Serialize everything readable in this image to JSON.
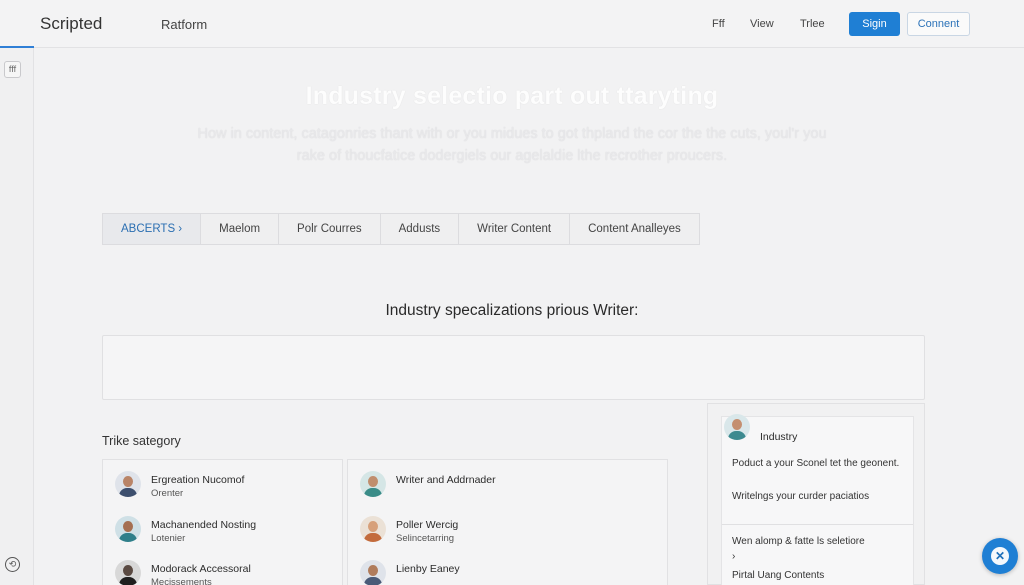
{
  "header": {
    "brand": "Scripted",
    "platform": "Ratform",
    "nav": [
      "Fff",
      "View",
      "Trlee"
    ],
    "signin_label": "Sigin",
    "connect_label": "Connent",
    "accent_color": "#1f7fd4"
  },
  "sidebar": {
    "toggle_icon": "fff",
    "back_icon": "⟲"
  },
  "hero": {
    "title": "Industry selectio part out ttaryting",
    "subtitle": "How in content, catagonries thant with or you midues to got thpland the cor the the cuts, youl'r you rake of thoucfatice dodergiels our agelaldie lthe recrother proucers."
  },
  "tabs": [
    {
      "label": "ABCERTS ›",
      "active": true
    },
    {
      "label": "Maelom",
      "active": false
    },
    {
      "label": "Polr Courres",
      "active": false
    },
    {
      "label": "Addusts",
      "active": false
    },
    {
      "label": "Writer Content",
      "active": false
    },
    {
      "label": "Content Analleyes",
      "active": false
    }
  ],
  "section": {
    "heading": "Industry specalizations prious Writer:",
    "category_label": "Trike sategory"
  },
  "list_left": [
    {
      "name": "Ergreation Nucomof",
      "sub": "Orenter"
    },
    {
      "name": "Machanended Nosting",
      "sub": "Lotenier"
    },
    {
      "name": "Modorack Accessoral",
      "sub": "Mecissements"
    }
  ],
  "list_right": [
    {
      "name": "Writer and Addrnader",
      "sub": ""
    },
    {
      "name": "Poller Wercig",
      "sub": "Selincetarring"
    },
    {
      "name": "Lienby Eaney",
      "sub": ""
    }
  ],
  "popup": {
    "title": "Industry",
    "line1": "Poduct a your Sconel tet the geonent.",
    "line2": "Writelngs your curder paciatios",
    "line3": "Wen alomp & fatte ls seletiore",
    "chevron": "›",
    "line4": "Pirtal Uang Contents"
  },
  "fab": {
    "close_glyph": "✕"
  }
}
